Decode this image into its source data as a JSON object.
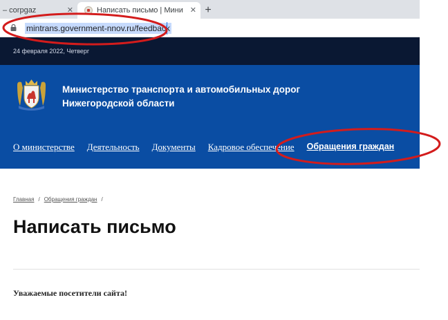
{
  "browser": {
    "tabs": [
      {
        "title": "– corpgaz",
        "close": "✕"
      },
      {
        "title": "Написать письмо | Министерство",
        "close": "✕"
      }
    ],
    "new_tab": "+",
    "url": "mintrans.government-nnov.ru/feedback"
  },
  "site": {
    "date": "24 февраля 2022, Четверг",
    "title_line1": "Министерство транспорта и автомобильных дорог",
    "title_line2": "Нижегородской области",
    "nav": [
      "О министерстве",
      "Деятельность",
      "Документы",
      "Кадровое обеспечение",
      "Обращения граждан"
    ],
    "breadcrumb": [
      "Главная",
      "Обращения граждан"
    ],
    "breadcrumb_sep": "/",
    "page_title": "Написать письмо",
    "greeting": "Уважаемые посетители сайта!"
  },
  "colors": {
    "header_bg": "#0a4da3",
    "date_bar_bg": "#0a1833",
    "annotation": "#d31c1c"
  },
  "icons": {
    "lock": "lock-icon",
    "favicon": "site-favicon-icon",
    "logo": "coat-of-arms-icon"
  }
}
